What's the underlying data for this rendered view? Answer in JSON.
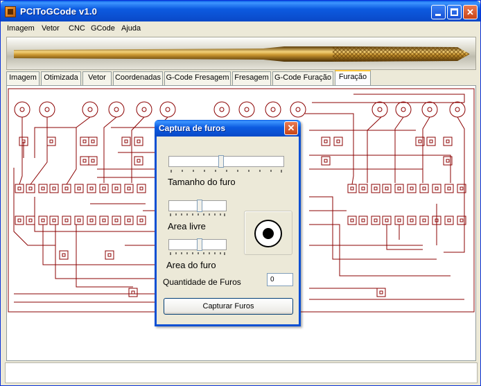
{
  "window": {
    "title": "PCIToGCode  v1.0",
    "minimize_icon": "minimize-icon",
    "maximize_icon": "maximize-icon",
    "close_icon": "close-icon",
    "close_glyph": "✕"
  },
  "menu": {
    "items": [
      "Imagem",
      "Vetor",
      "CNC",
      "GCode",
      "Ajuda"
    ]
  },
  "tabs": {
    "items": [
      "Imagem",
      "Otimizada",
      "Vetor",
      "Coordenadas",
      "G-Code Fresagem",
      "Fresagem",
      "G-Code Furação",
      "Furação"
    ],
    "active": "Furação"
  },
  "dialog": {
    "title": "Captura de furos",
    "close_glyph": "✕",
    "hole_size_label": "Tamanho do furo",
    "hole_size_level": 0.45,
    "free_area_label": "Area livre",
    "free_area_level": 0.55,
    "hole_area_label": "Area do furo",
    "hole_area_level": 0.55,
    "quantity_label": "Quantidade de Furos",
    "quantity_value": "0",
    "capture_button": "Capturar Furos"
  },
  "colors": {
    "trace": "#8b0000",
    "titlebar": "#0a5fe6",
    "dialog_border": "#0a4fd3"
  }
}
